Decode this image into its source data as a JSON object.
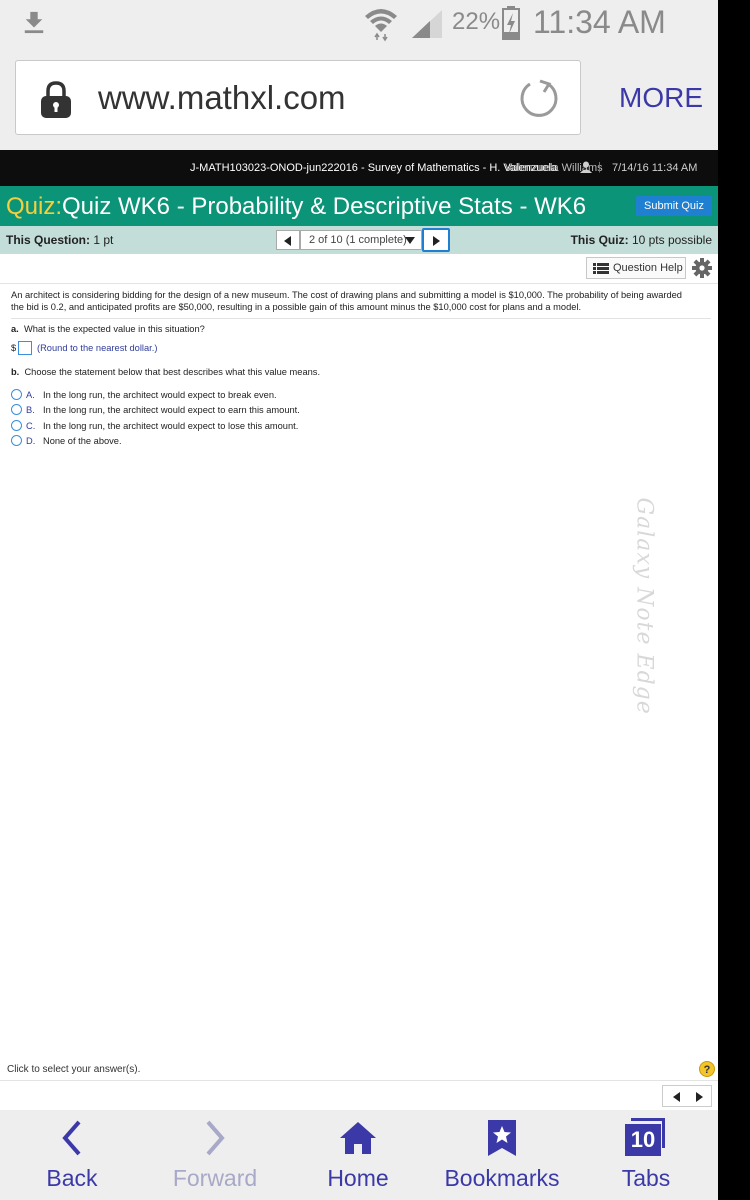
{
  "status_bar": {
    "battery_percent": "22%",
    "time": "11:34 AM"
  },
  "browser": {
    "url": "www.mathxl.com",
    "more_label": "MORE"
  },
  "course_bar": {
    "course_title": "J-MATH103023-ONOD-jun222016 - Survey of Mathematics - H. Valenzuela",
    "user_name": "Valenzuela Williams",
    "separator": "|",
    "datetime": "7/14/16 11:34 AM"
  },
  "quiz_header": {
    "quiz_label": "Quiz:",
    "quiz_name": "Quiz WK6 - Probability & Descriptive Stats - WK6",
    "submit_label": "Submit Quiz"
  },
  "info_bar": {
    "this_question_label": "This Question:",
    "this_question_value": "1 pt",
    "question_select": "2 of 10 (1 complete)",
    "this_quiz_label": "This Quiz:",
    "this_quiz_value": "10 pts possible"
  },
  "help": {
    "question_help_label": "Question Help"
  },
  "question": {
    "stem": "An architect is considering bidding for the design of a new museum.  The cost of drawing plans and submitting a model is $10,000.  The probability of being awarded the bid is 0.2, and anticipated profits are $50,000, resulting in a possible gain of this amount minus the $10,000 cost for plans and a model.",
    "part_a_label": "a.",
    "part_a_text": "What is the expected value in this situation?",
    "currency": "$",
    "round_note": "(Round to the nearest dollar.)",
    "part_b_label": "b.",
    "part_b_text": "Choose the statement below that best describes what this value means.",
    "options": [
      {
        "letter": "A.",
        "text": "In the long run, the architect would expect to break even."
      },
      {
        "letter": "B.",
        "text": "In the long run, the architect would expect to earn this amount."
      },
      {
        "letter": "C.",
        "text": "In the long run, the architect would expect to lose this amount."
      },
      {
        "letter": "D.",
        "text": "None of the above."
      }
    ]
  },
  "footer": {
    "click_hint": "Click to select your answer(s).",
    "help_symbol": "?"
  },
  "nav": {
    "back_label": "Back",
    "forward_label": "Forward",
    "home_label": "Home",
    "bookmarks_label": "Bookmarks",
    "tabs_label": "Tabs",
    "tabs_count": "10"
  },
  "device": {
    "edge_text": "Galaxy Note Edge"
  },
  "colors": {
    "quiz_bar": "#0c9478",
    "quiz_label": "#f6cf3d",
    "nav_accent": "#3b39a8",
    "submit_button": "#1f7fd1"
  }
}
